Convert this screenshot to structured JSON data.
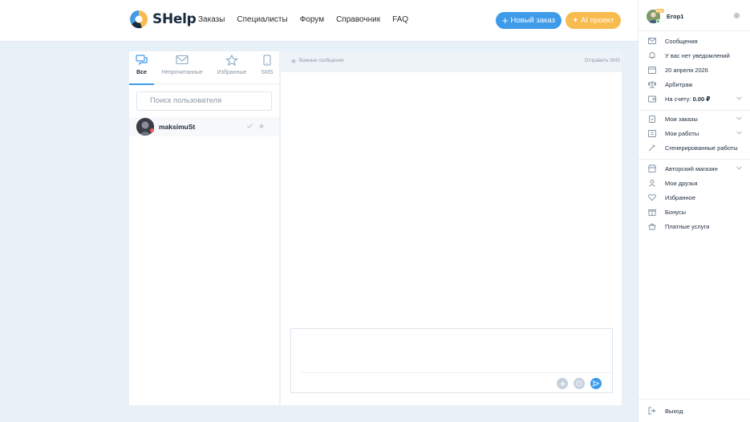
{
  "header": {
    "logo_text": "SHelp",
    "nav": [
      "Заказы",
      "Специалисты",
      "Форум",
      "Справочник",
      "FAQ"
    ],
    "new_order_label": "Новый заказ",
    "ai_project_label": "AI проект"
  },
  "chat_list": {
    "tabs": [
      {
        "label": "Все",
        "icon": "chat-icon"
      },
      {
        "label": "Непрочитанные",
        "icon": "envelope-icon"
      },
      {
        "label": "Избранные",
        "icon": "star-icon"
      },
      {
        "label": "SMS",
        "icon": "phone-icon"
      }
    ],
    "search_placeholder": "Поиск пользователя",
    "chats": [
      {
        "name": "maksimuSt"
      }
    ]
  },
  "chat": {
    "important_label": "Важные сообщения",
    "send_sms_label": "Отправить SMS",
    "composer_buttons": [
      "plus-icon",
      "emoji-icon",
      "send-icon"
    ]
  },
  "sidebar": {
    "user_badge": "PRO",
    "user_name": "Егор1",
    "menu": [
      {
        "label": "Сообщения",
        "icon": "envelope-icon"
      },
      {
        "label": "У вас нет уведомлений",
        "icon": "bell-icon"
      },
      {
        "label": "20 апреля 2026",
        "icon": "calendar-icon"
      },
      {
        "label": "Арбитраж",
        "icon": "scales-icon"
      },
      {
        "label": "На счету:",
        "value": "0.00 ₽",
        "icon": "wallet-icon"
      },
      {
        "label": "Мои заказы",
        "icon": "clipboard-icon"
      },
      {
        "label": "Мои работы",
        "icon": "briefcase-icon"
      },
      {
        "label": "Сгенерированные работы",
        "icon": "magic-wand-icon"
      },
      {
        "label": "Авторский магазин",
        "icon": "shop-icon"
      },
      {
        "label": "Мои друзья",
        "icon": "user-icon"
      },
      {
        "label": "Избранное",
        "icon": "heart-icon"
      },
      {
        "label": "Бонусы",
        "icon": "gift-icon"
      },
      {
        "label": "Платные услуги",
        "icon": "paid-services-icon"
      }
    ],
    "logout_label": "Выход"
  },
  "colors": {
    "accent": "#3d9be9",
    "ai_button": "#f8bb4f",
    "background": "#e9f1f8"
  }
}
